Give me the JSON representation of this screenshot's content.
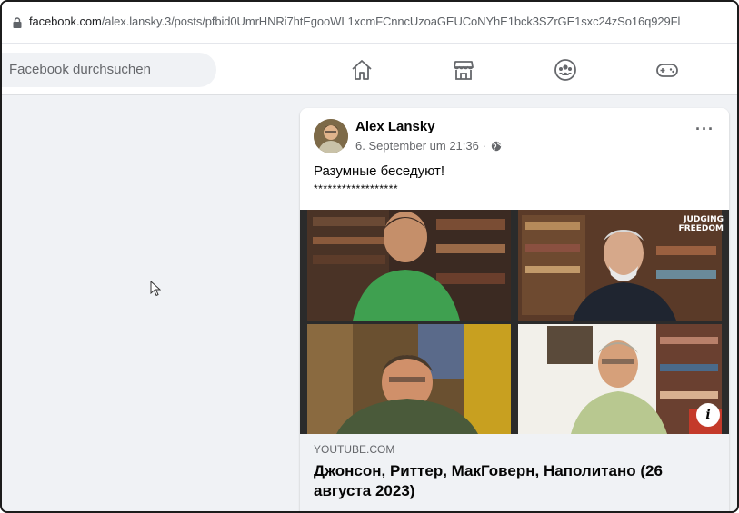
{
  "browser": {
    "url_domain": "facebook.com",
    "url_path": "/alex.lansky.3/posts/pfbid0UmrHNRi7htEgooWL1xcmFCnncUzoaGEUCoNYhE1bck3SZrGE1sxc24zSo16q929Fl"
  },
  "header": {
    "search_placeholder": "Facebook durchsuchen",
    "nav_icons": [
      "home-icon",
      "marketplace-icon",
      "groups-icon",
      "gaming-icon"
    ]
  },
  "post": {
    "author": "Alex Lansky",
    "timestamp": "6. September um 21:36 ·",
    "privacy_icon": "globe-icon",
    "more_label": "···",
    "text": "Разумные беседуют!",
    "stars": "******************",
    "media": {
      "watermark_line1": "JUDGING",
      "watermark_line2": "FREEDOM",
      "info_label": "i"
    },
    "link": {
      "domain": "YOUTUBE.COM",
      "title": "Джонсон, Риттер, МакГоверн, Наполитано (26 августа 2023)"
    }
  },
  "colors": {
    "background": "#f0f2f5",
    "card": "#ffffff",
    "text_primary": "#050505",
    "text_secondary": "#65676b"
  }
}
